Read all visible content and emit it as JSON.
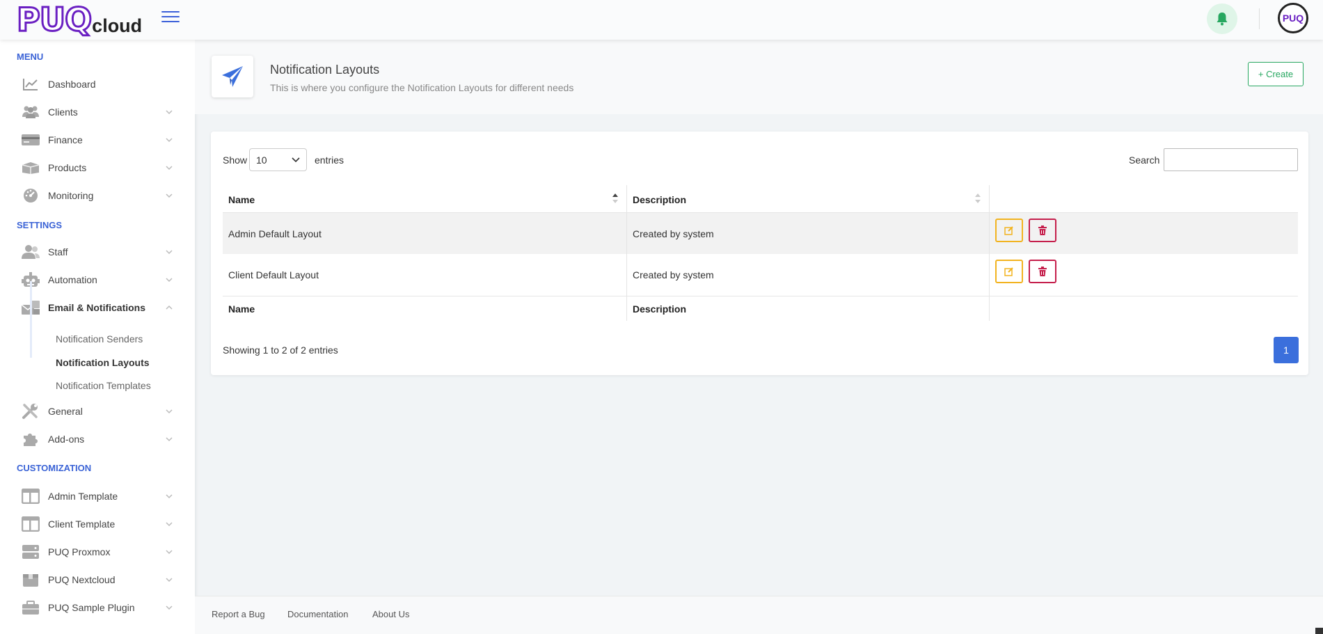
{
  "header": {
    "logo_main": "PUQ",
    "logo_sub": "cloud",
    "avatar_text": "PUQ"
  },
  "sidebar": {
    "sections": {
      "menu": "MENU",
      "settings": "SETTINGS",
      "customization": "CUSTOMIZATION"
    },
    "items": {
      "dashboard": "Dashboard",
      "clients": "Clients",
      "finance": "Finance",
      "products": "Products",
      "monitoring": "Monitoring",
      "staff": "Staff",
      "automation": "Automation",
      "email_notifications": "Email & Notifications",
      "general": "General",
      "addons": "Add-ons",
      "admin_template": "Admin Template",
      "client_template": "Client Template",
      "puq_proxmox": "PUQ Proxmox",
      "puq_nextcloud": "PUQ Nextcloud",
      "puq_sample_plugin": "PUQ Sample Plugin"
    },
    "submenu": {
      "senders": "Notification Senders",
      "layouts": "Notification Layouts",
      "templates": "Notification Templates"
    }
  },
  "page": {
    "title": "Notification Layouts",
    "subtitle": "This is where you configure the Notification Layouts for different needs",
    "create_label": "+ Create"
  },
  "table": {
    "show_label": "Show",
    "entries_value": "10",
    "entries_label": "entries",
    "search_label": "Search",
    "search_value": "",
    "columns": [
      "Name",
      "Description"
    ],
    "rows": [
      {
        "name": "Admin Default Layout",
        "description": "Created by system"
      },
      {
        "name": "Client Default Layout",
        "description": "Created by system"
      }
    ],
    "info": "Showing 1 to 2 of 2 entries",
    "current_page": "1"
  },
  "footer": {
    "report_bug": "Report a Bug",
    "documentation": "Documentation",
    "about_us": "About Us"
  },
  "colors": {
    "accent": "#3b63d6",
    "create": "#27a760",
    "edit": "#f2b31f",
    "delete": "#c51e4b",
    "logo": "#6a1fc2"
  }
}
